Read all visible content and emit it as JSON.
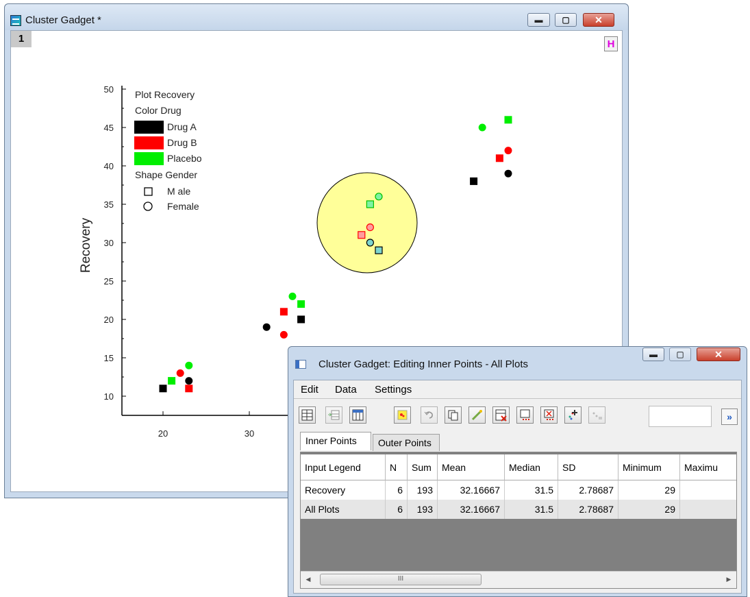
{
  "main_window": {
    "title": "Cluster Gadget *",
    "layer_number": "1",
    "h_badge": "H",
    "buttons": {
      "minimize": "▬",
      "maximize": "▢",
      "close": "✕"
    }
  },
  "plot": {
    "ylabel": "Recovery",
    "yticks": [
      "10",
      "15",
      "20",
      "25",
      "30",
      "35",
      "40",
      "45",
      "50"
    ],
    "xticks": [
      "20",
      "30"
    ],
    "legend": {
      "plot_line": "Plot Recovery",
      "color_header": "Color Drug",
      "colors": [
        {
          "label": "Drug A",
          "color": "#000000"
        },
        {
          "label": "Drug B",
          "color": "#ff0000"
        },
        {
          "label": "Placebo",
          "color": "#00ee00"
        }
      ],
      "shape_header": "Shape  Gender",
      "shapes": [
        {
          "label": "M ale",
          "shape": "square"
        },
        {
          "label": "Female",
          "shape": "circle"
        }
      ]
    },
    "cluster_fill": "#ffff99",
    "points": [
      {
        "x": 20,
        "y": 11,
        "drug": "A",
        "shape": "square"
      },
      {
        "x": 21,
        "y": 12,
        "drug": "Placebo",
        "shape": "square"
      },
      {
        "x": 22,
        "y": 13,
        "drug": "B",
        "shape": "circle"
      },
      {
        "x": 23,
        "y": 12,
        "drug": "A",
        "shape": "circle"
      },
      {
        "x": 23,
        "y": 11,
        "drug": "B",
        "shape": "square"
      },
      {
        "x": 23,
        "y": 14,
        "drug": "Placebo",
        "shape": "circle"
      },
      {
        "x": 32,
        "y": 19,
        "drug": "A",
        "shape": "circle"
      },
      {
        "x": 34,
        "y": 21,
        "drug": "B",
        "shape": "square"
      },
      {
        "x": 34,
        "y": 18,
        "drug": "B",
        "shape": "circle"
      },
      {
        "x": 35,
        "y": 23,
        "drug": "Placebo",
        "shape": "circle"
      },
      {
        "x": 36,
        "y": 22,
        "drug": "Placebo",
        "shape": "square"
      },
      {
        "x": 36,
        "y": 20,
        "drug": "A",
        "shape": "square"
      },
      {
        "x": 43,
        "y": 31,
        "drug": "B",
        "shape": "square",
        "selected": true
      },
      {
        "x": 44,
        "y": 32,
        "drug": "B",
        "shape": "circle",
        "selected": true
      },
      {
        "x": 44,
        "y": 30,
        "drug": "A",
        "shape": "circle",
        "selected": true
      },
      {
        "x": 45,
        "y": 29,
        "drug": "A",
        "shape": "square",
        "selected": true
      },
      {
        "x": 44,
        "y": 35,
        "drug": "Placebo",
        "shape": "square",
        "selected": true
      },
      {
        "x": 45,
        "y": 36,
        "drug": "Placebo",
        "shape": "circle",
        "selected": true
      },
      {
        "x": 57,
        "y": 45,
        "drug": "Placebo",
        "shape": "circle"
      },
      {
        "x": 60,
        "y": 46,
        "drug": "Placebo",
        "shape": "square"
      },
      {
        "x": 59,
        "y": 41,
        "drug": "B",
        "shape": "square"
      },
      {
        "x": 60,
        "y": 42,
        "drug": "B",
        "shape": "circle"
      },
      {
        "x": 56,
        "y": 38,
        "drug": "A",
        "shape": "square"
      },
      {
        "x": 60,
        "y": 39,
        "drug": "A",
        "shape": "circle"
      }
    ]
  },
  "dialog": {
    "title": "Cluster Gadget: Editing Inner Points - All Plots",
    "menu": [
      "Edit",
      "Data",
      "Settings"
    ],
    "toolbar_icons": [
      "worksheet-icon",
      "add-column-icon",
      "table-icon",
      "point-select-icon",
      "undo-icon",
      "copy-icon",
      "mask-icon",
      "set-value-icon",
      "delete-icon",
      "extract-icon",
      "remove-points-icon",
      "add-points-icon",
      "reset-icon"
    ],
    "collapse_label": "»",
    "tabs": [
      "Inner Points",
      "Outer Points"
    ],
    "columns": [
      "Input Legend",
      "N",
      "Sum",
      "Mean",
      "Median",
      "SD",
      "Minimum",
      "Maximu"
    ],
    "rows": [
      [
        "Recovery",
        "6",
        "193",
        "32.16667",
        "31.5",
        "2.78687",
        "29",
        ""
      ],
      [
        "All Plots",
        "6",
        "193",
        "32.16667",
        "31.5",
        "2.78687",
        "29",
        ""
      ]
    ],
    "scroll_grip": "III"
  }
}
